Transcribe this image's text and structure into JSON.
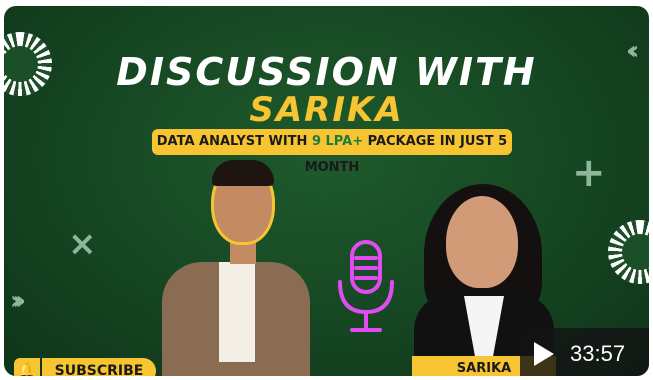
{
  "thumbnail": {
    "title_line1": "DISCUSSION WITH",
    "title_line2": "SARIKA",
    "subtitle_part1": "DATA ANALYST WITH ",
    "subtitle_highlight": "9 LPA+",
    "subtitle_part2": " PACKAGE IN JUST 5 MONTH",
    "guest_name": "SARIKA",
    "subscribe_label": "SUBSCRIBE",
    "duration": "33:57",
    "colors": {
      "background": "#174a24",
      "accent_yellow": "#f7c531",
      "mic_glow": "#e04cf2"
    },
    "icons": [
      "bell-icon",
      "play-icon",
      "microphone-icon"
    ]
  }
}
